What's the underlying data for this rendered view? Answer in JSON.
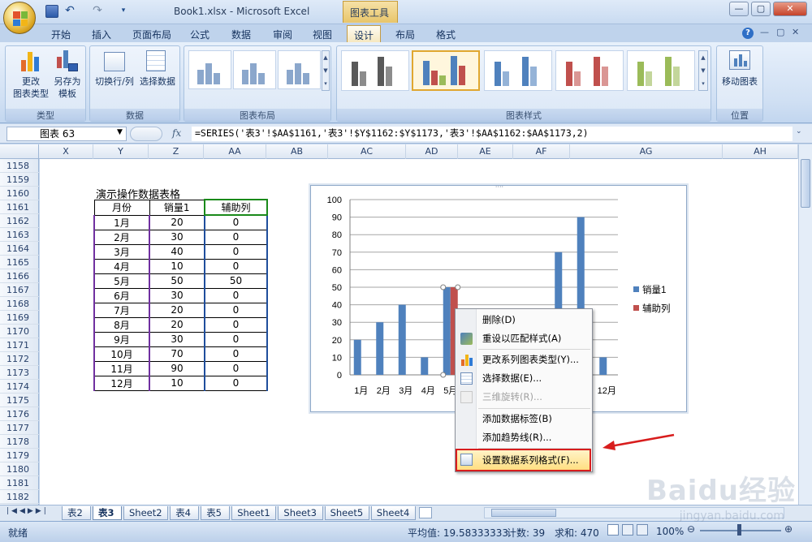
{
  "titlebar": {
    "window_title": "Book1.xlsx - Microsoft Excel",
    "context_title": "图表工具",
    "qat_undo": "↶",
    "qat_redo": "↷",
    "minimize": "—",
    "restore": "▢",
    "close": "✕"
  },
  "tabs": [
    "开始",
    "插入",
    "页面布局",
    "公式",
    "数据",
    "审阅",
    "视图",
    "设计",
    "布局",
    "格式"
  ],
  "active_tab": "设计",
  "ribbon_right": {
    "help": "?",
    "min": "—",
    "restore": "▢",
    "close": "✕"
  },
  "ribbon": {
    "groups": {
      "type": {
        "label": "类型",
        "btn1": "更改\n图表类型",
        "btn2": "另存为\n模板"
      },
      "data": {
        "label": "数据",
        "btn1": "切换行/列",
        "btn2": "选择数据"
      },
      "layout": {
        "label": "图表布局"
      },
      "styles": {
        "label": "图表样式"
      },
      "location": {
        "label": "位置",
        "btn1": "移动图表"
      }
    }
  },
  "formula_bar": {
    "name_box": "图表 63",
    "fx": "fx",
    "formula": "=SERIES('表3'!$AA$1161,'表3'!$Y$1162:$Y$1173,'表3'!$AA$1162:$AA$1173,2)"
  },
  "columns": [
    "X",
    "Y",
    "Z",
    "AA",
    "AB",
    "AC",
    "AD",
    "AE",
    "AF",
    "AG",
    "AH"
  ],
  "rows": [
    "1158",
    "1159",
    "1160",
    "1161",
    "1162",
    "1163",
    "1164",
    "1165",
    "1166",
    "1167",
    "1168",
    "1169",
    "1170",
    "1171",
    "1172",
    "1173",
    "1174",
    "1175",
    "1176",
    "1177",
    "1178",
    "1179",
    "1180",
    "1181",
    "1182"
  ],
  "table": {
    "title": "演示操作数据表格",
    "headers": [
      "月份",
      "销量1",
      "辅助列"
    ],
    "rows": [
      [
        "1月",
        "20",
        "0"
      ],
      [
        "2月",
        "30",
        "0"
      ],
      [
        "3月",
        "40",
        "0"
      ],
      [
        "4月",
        "10",
        "0"
      ],
      [
        "5月",
        "50",
        "50"
      ],
      [
        "6月",
        "30",
        "0"
      ],
      [
        "7月",
        "20",
        "0"
      ],
      [
        "8月",
        "20",
        "0"
      ],
      [
        "9月",
        "30",
        "0"
      ],
      [
        "10月",
        "70",
        "0"
      ],
      [
        "11月",
        "90",
        "0"
      ],
      [
        "12月",
        "10",
        "0"
      ]
    ]
  },
  "chart_data": {
    "type": "bar",
    "categories": [
      "1月",
      "2月",
      "3月",
      "4月",
      "5月",
      "6月",
      "7月",
      "8月",
      "9月",
      "10月",
      "11月",
      "12月"
    ],
    "series": [
      {
        "name": "销量1",
        "values": [
          20,
          30,
          40,
          10,
          50,
          30,
          20,
          20,
          30,
          70,
          90,
          10
        ],
        "color": "#4f81bd"
      },
      {
        "name": "辅助列",
        "values": [
          0,
          0,
          0,
          0,
          50,
          0,
          0,
          0,
          0,
          0,
          0,
          0
        ],
        "color": "#c0504d"
      }
    ],
    "yticks": [
      "0",
      "10",
      "20",
      "30",
      "40",
      "50",
      "60",
      "70",
      "80",
      "90",
      "100"
    ],
    "ylim": [
      0,
      100
    ],
    "grid": true,
    "legend": "right"
  },
  "context_menu": {
    "items": [
      {
        "label": "删除(D)",
        "enabled": true,
        "icon": "delete-icon"
      },
      {
        "label": "重设以匹配样式(A)",
        "enabled": true,
        "icon": "reset-style-icon"
      },
      {
        "label": "更改系列图表类型(Y)...",
        "enabled": true,
        "icon": "chart-type-icon"
      },
      {
        "label": "选择数据(E)...",
        "enabled": true,
        "icon": "select-data-icon"
      },
      {
        "label": "三维旋转(R)...",
        "enabled": false,
        "icon": "3d-rotate-icon"
      },
      {
        "label": "添加数据标签(B)",
        "enabled": true,
        "icon": ""
      },
      {
        "label": "添加趋势线(R)...",
        "enabled": true,
        "icon": ""
      },
      {
        "label": "设置数据系列格式(F)...",
        "enabled": true,
        "icon": "format-series-icon"
      }
    ]
  },
  "sheet_tabs": [
    "表2",
    "表3",
    "Sheet2",
    "表4",
    "表5",
    "Sheet1",
    "Sheet3",
    "Sheet5",
    "Sheet4"
  ],
  "active_sheet": "表3",
  "status": {
    "ready": "就绪",
    "average": "平均值: 19.58333333",
    "count": "计数: 39",
    "sum": "求和: 470",
    "zoom": "100%"
  },
  "watermark": {
    "brand": "Baidu经验",
    "url": "jingyan.baidu.com"
  },
  "colors": {
    "accent": "#4f81bd",
    "secondary": "#c0504d",
    "highlight": "#d81d1d",
    "arrow": "#d81d1d"
  }
}
